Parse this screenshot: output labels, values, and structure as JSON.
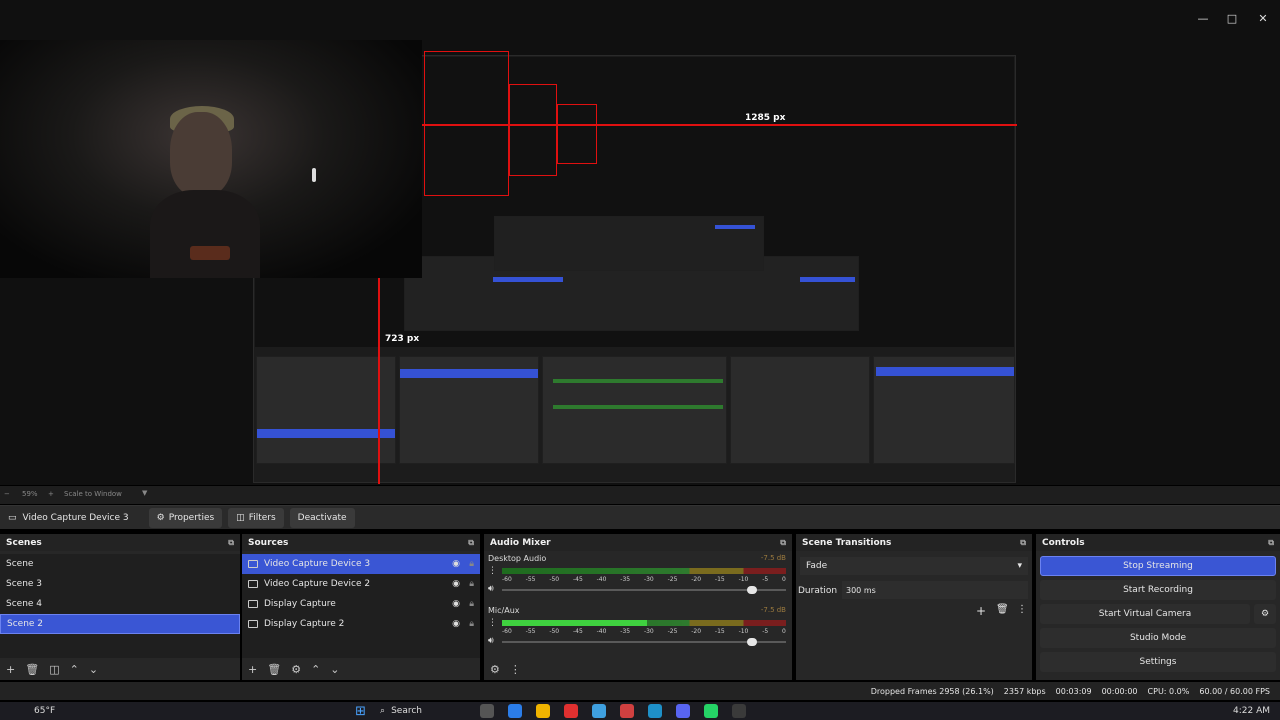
{
  "window": {
    "minimize": "—",
    "maximize": "□",
    "close": "✕"
  },
  "preview": {
    "width_label": "1285 px",
    "height_label": "723 px"
  },
  "toolbar": {
    "zoom": "59%",
    "scale_mode": "Scale to Window",
    "source_name": "Video Capture Device 3",
    "properties": "Properties",
    "filters": "Filters",
    "deactivate": "Deactivate"
  },
  "scenes": {
    "title": "Scenes",
    "items": [
      "Scene",
      "Scene 3",
      "Scene 4",
      "Scene 2"
    ],
    "selected_index": 3
  },
  "sources": {
    "title": "Sources",
    "items": [
      "Video Capture Device 3",
      "Video Capture Device 2",
      "Display Capture",
      "Display Capture 2"
    ],
    "selected_index": 0
  },
  "mixer": {
    "title": "Audio Mixer",
    "channels": [
      {
        "name": "Desktop Audio",
        "db": "-7.5 dB",
        "level": 0.0,
        "volume": 0.88
      },
      {
        "name": "Mic/Aux",
        "db": "-7.5 dB",
        "level": 0.51,
        "volume": 0.88
      }
    ],
    "ticks": [
      "-60",
      "-55",
      "-50",
      "-45",
      "-40",
      "-35",
      "-30",
      "-25",
      "-20",
      "-15",
      "-10",
      "-5",
      "0"
    ]
  },
  "transitions": {
    "title": "Scene Transitions",
    "type": "Fade",
    "duration_label": "Duration",
    "duration_value": "300 ms"
  },
  "controls": {
    "title": "Controls",
    "stop_streaming": "Stop Streaming",
    "start_recording": "Start Recording",
    "start_virtual_camera": "Start Virtual Camera",
    "studio_mode": "Studio Mode",
    "settings": "Settings"
  },
  "status": {
    "dropped": "Dropped Frames 2958 (26.1%)",
    "bitrate": "2357 kbps",
    "stream_time": "00:03:09",
    "rec_time": "00:00:00",
    "cpu": "CPU: 0.0%",
    "fps": "60.00 / 60.00 FPS"
  },
  "taskbar": {
    "weather": "65°F",
    "search": "Search",
    "time": "4:22 AM"
  },
  "colors": {
    "accent": "#3a56d4",
    "guide": "#e01010",
    "panel": "#272727"
  }
}
